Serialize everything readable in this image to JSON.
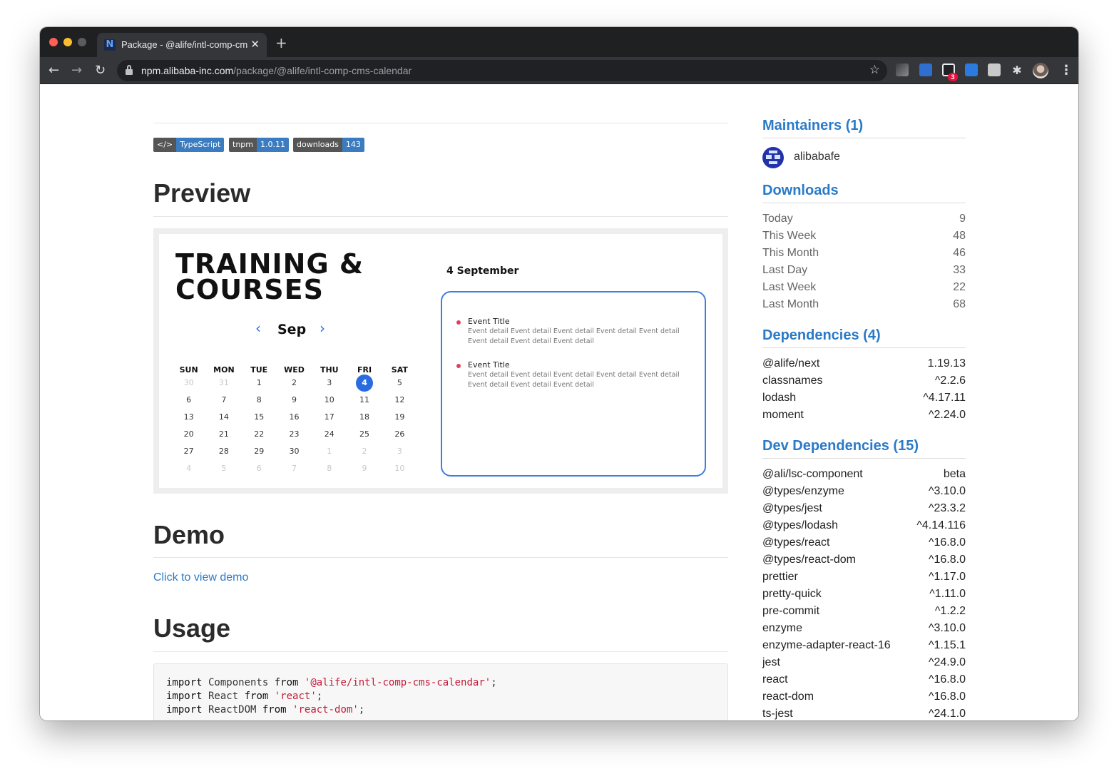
{
  "browser": {
    "tab_title": "Package - @alife/intl-comp-cms-calendar",
    "tab_favicon": "N",
    "url_host": "npm.alibaba-inc.com",
    "url_path": "/package/@alife/intl-comp-cms-calendar",
    "icons": [
      "back-arrow-icon",
      "forward-arrow-icon",
      "reload-icon",
      "lock-icon",
      "star-icon",
      "extensions-icon",
      "profile-avatar",
      "more-menu-icon"
    ],
    "extension_badge": "3"
  },
  "badges": [
    {
      "left": "</>",
      "right": "TypeScript"
    },
    {
      "left": "tnpm",
      "right": "1.0.11"
    },
    {
      "left": "downloads",
      "right": "143"
    }
  ],
  "sections": {
    "preview": "Preview",
    "demo": "Demo",
    "usage": "Usage"
  },
  "preview_widget": {
    "title": "TRAINING &\nCOURSES",
    "month": "Sep",
    "weekdays": [
      "SUN",
      "MON",
      "TUE",
      "WED",
      "THU",
      "FRI",
      "SAT"
    ],
    "weeks": [
      [
        {
          "d": "30",
          "m": true
        },
        {
          "d": "31",
          "m": true
        },
        {
          "d": "1"
        },
        {
          "d": "2"
        },
        {
          "d": "3"
        },
        {
          "d": "4",
          "s": true
        },
        {
          "d": "5"
        }
      ],
      [
        {
          "d": "6"
        },
        {
          "d": "7"
        },
        {
          "d": "8"
        },
        {
          "d": "9"
        },
        {
          "d": "10"
        },
        {
          "d": "11"
        },
        {
          "d": "12"
        }
      ],
      [
        {
          "d": "13"
        },
        {
          "d": "14"
        },
        {
          "d": "15"
        },
        {
          "d": "16"
        },
        {
          "d": "17"
        },
        {
          "d": "18"
        },
        {
          "d": "19"
        }
      ],
      [
        {
          "d": "20"
        },
        {
          "d": "21"
        },
        {
          "d": "22"
        },
        {
          "d": "23"
        },
        {
          "d": "24"
        },
        {
          "d": "25"
        },
        {
          "d": "26"
        }
      ],
      [
        {
          "d": "27"
        },
        {
          "d": "28"
        },
        {
          "d": "29"
        },
        {
          "d": "30"
        },
        {
          "d": "1",
          "m": true
        },
        {
          "d": "2",
          "m": true
        },
        {
          "d": "3",
          "m": true
        }
      ],
      [
        {
          "d": "4",
          "m": true
        },
        {
          "d": "5",
          "m": true
        },
        {
          "d": "6",
          "m": true
        },
        {
          "d": "7",
          "m": true
        },
        {
          "d": "8",
          "m": true
        },
        {
          "d": "9",
          "m": true
        },
        {
          "d": "10",
          "m": true
        }
      ]
    ],
    "event_date": "4 September",
    "events": [
      {
        "title": "Event Title",
        "detail": "Event detail Event detail Event detail Event detail Event detail Event detail Event detail Event detail"
      },
      {
        "title": "Event Title",
        "detail": "Event detail Event detail Event detail Event detail Event detail Event detail Event detail Event detail"
      }
    ]
  },
  "demo_link": "Click to view demo",
  "usage_code": [
    [
      {
        "t": "import",
        "c": "kw"
      },
      {
        "t": " Components "
      },
      {
        "t": "from",
        "c": "kw"
      },
      {
        "t": " "
      },
      {
        "t": "'@alife/intl-comp-cms-calendar'",
        "c": "str"
      },
      {
        "t": ";"
      }
    ],
    [
      {
        "t": "import",
        "c": "kw"
      },
      {
        "t": " React "
      },
      {
        "t": "from",
        "c": "kw"
      },
      {
        "t": " "
      },
      {
        "t": "'react'",
        "c": "str"
      },
      {
        "t": ";"
      }
    ],
    [
      {
        "t": "import",
        "c": "kw"
      },
      {
        "t": " ReactDOM "
      },
      {
        "t": "from",
        "c": "kw"
      },
      {
        "t": " "
      },
      {
        "t": "'react-dom'",
        "c": "str"
      },
      {
        "t": ";"
      }
    ]
  ],
  "sidebar": {
    "maintainers_heading": "Maintainers (1)",
    "maintainer_name": "alibabafe",
    "downloads_heading": "Downloads",
    "downloads": [
      {
        "k": "Today",
        "v": "9"
      },
      {
        "k": "This Week",
        "v": "48"
      },
      {
        "k": "This Month",
        "v": "46"
      },
      {
        "k": "Last Day",
        "v": "33"
      },
      {
        "k": "Last Week",
        "v": "22"
      },
      {
        "k": "Last Month",
        "v": "68"
      }
    ],
    "dependencies_heading": "Dependencies (4)",
    "dependencies": [
      {
        "k": "@alife/next",
        "v": "1.19.13"
      },
      {
        "k": "classnames",
        "v": "^2.2.6"
      },
      {
        "k": "lodash",
        "v": "^4.17.11"
      },
      {
        "k": "moment",
        "v": "^2.24.0"
      }
    ],
    "dev_dependencies_heading": "Dev Dependencies (15)",
    "dev_dependencies": [
      {
        "k": "@ali/lsc-component",
        "v": "beta"
      },
      {
        "k": "@types/enzyme",
        "v": "^3.10.0"
      },
      {
        "k": "@types/jest",
        "v": "^23.3.2"
      },
      {
        "k": "@types/lodash",
        "v": "^4.14.116"
      },
      {
        "k": "@types/react",
        "v": "^16.8.0"
      },
      {
        "k": "@types/react-dom",
        "v": "^16.8.0"
      },
      {
        "k": "prettier",
        "v": "^1.17.0"
      },
      {
        "k": "pretty-quick",
        "v": "^1.11.0"
      },
      {
        "k": "pre-commit",
        "v": "^1.2.2"
      },
      {
        "k": "enzyme",
        "v": "^3.10.0"
      },
      {
        "k": "enzyme-adapter-react-16",
        "v": "^1.15.1"
      },
      {
        "k": "jest",
        "v": "^24.9.0"
      },
      {
        "k": "react",
        "v": "^16.8.0"
      },
      {
        "k": "react-dom",
        "v": "^16.8.0"
      },
      {
        "k": "ts-jest",
        "v": "^24.1.0"
      }
    ]
  }
}
